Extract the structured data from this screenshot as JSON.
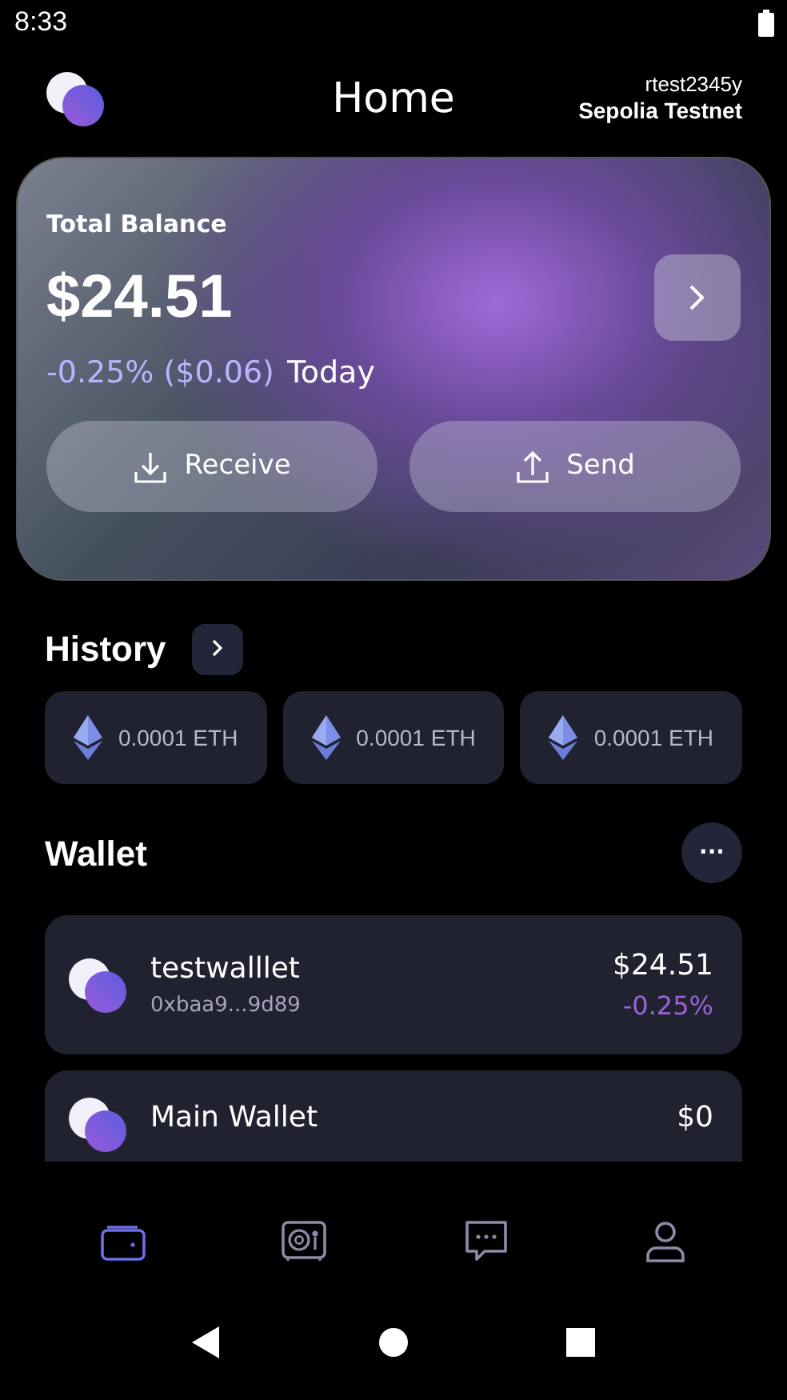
{
  "status_bar": {
    "time": "8:33"
  },
  "header": {
    "title": "Home",
    "account": "rtest2345y",
    "network": "Sepolia Testnet"
  },
  "balance_card": {
    "label": "Total Balance",
    "amount": "$24.51",
    "change": "-0.25% ($0.06)",
    "period": "Today",
    "buttons": [
      "Receive",
      "Send"
    ]
  },
  "history": {
    "title": "History",
    "items": [
      {
        "amount": "0.0001 ETH"
      },
      {
        "amount": "0.0001 ETH"
      },
      {
        "amount": "0.0001 ETH"
      }
    ]
  },
  "wallet": {
    "title": "Wallet",
    "more": "···",
    "items": [
      {
        "name": "testwalllet",
        "address": "0xbaa9...9d89",
        "balance": "$24.51",
        "change": "-0.25%"
      },
      {
        "name": "Main Wallet",
        "balance": "$0"
      }
    ]
  },
  "bottom_nav": [
    {
      "kind": "wallet",
      "selected": true
    },
    {
      "kind": "safe",
      "selected": false
    },
    {
      "kind": "chat",
      "selected": false
    },
    {
      "kind": "profile",
      "selected": false
    }
  ]
}
